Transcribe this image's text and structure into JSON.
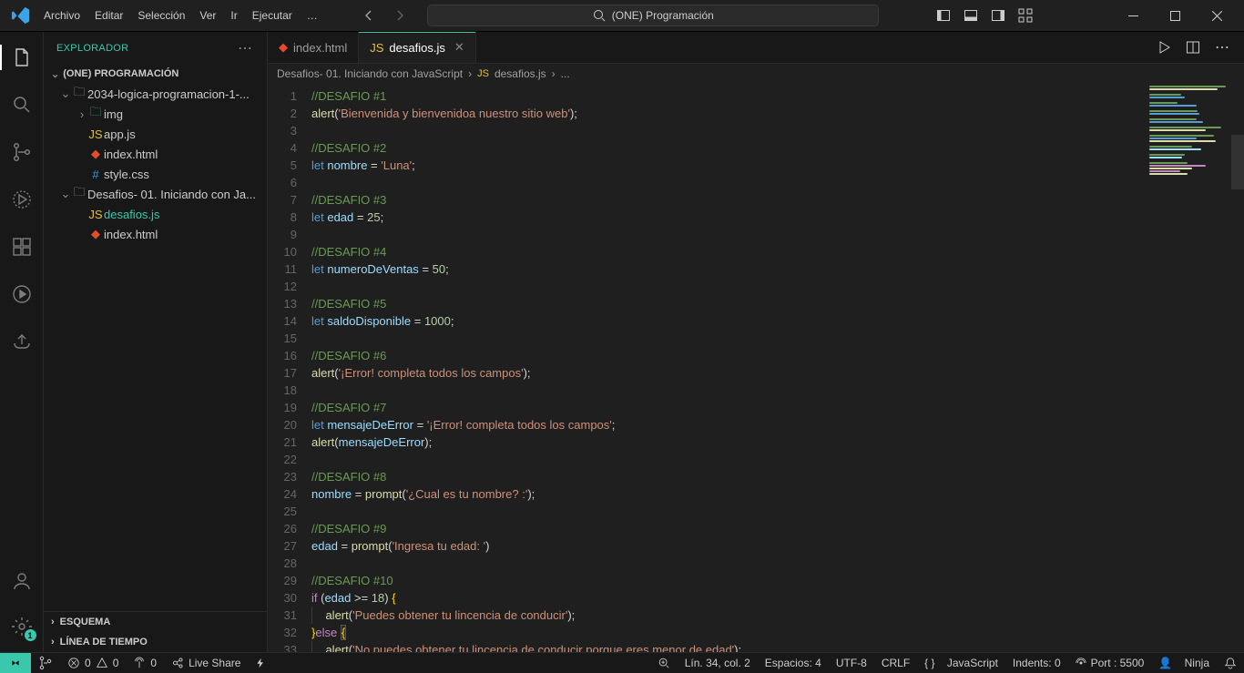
{
  "menu": [
    "Archivo",
    "Editar",
    "Selección",
    "Ver",
    "Ir",
    "Ejecutar"
  ],
  "menu_overflow": "…",
  "search_center": "(ONE) Programación",
  "explorer": {
    "title": "EXPLORADOR",
    "root": "(ONE) PROGRAMACIÓN",
    "folder1": "2034-logica-programacion-1-...",
    "img": "img",
    "appjs": "app.js",
    "indexhtml": "index.html",
    "stylecss": "style.css",
    "folder2": "Desafios- 01. Iniciando con Ja...",
    "desafiosjs": "desafios.js",
    "indexhtml2": "index.html",
    "esquema": "ESQUEMA",
    "linea": "LÍNEA DE TIEMPO"
  },
  "tabs": {
    "indexhtml": "index.html",
    "desafiosjs": "desafios.js"
  },
  "breadcrumbs": {
    "seg1": "Desafios- 01. Iniciando con JavaScript",
    "seg2": "desafios.js",
    "seg3": "..."
  },
  "code_lines": [
    {
      "n": 1,
      "t": [
        [
          "cm",
          "//DESAFIO #1"
        ]
      ]
    },
    {
      "n": 2,
      "t": [
        [
          "fn",
          "alert"
        ],
        [
          "p",
          "("
        ],
        [
          "str",
          "'Bienvenida y bienvenidoa nuestro sitio web'"
        ],
        [
          "p",
          ");"
        ]
      ]
    },
    {
      "n": 3,
      "t": []
    },
    {
      "n": 4,
      "t": [
        [
          "cm",
          "//DESAFIO #2"
        ]
      ]
    },
    {
      "n": 5,
      "t": [
        [
          "kw",
          "let "
        ],
        [
          "id",
          "nombre"
        ],
        [
          "p",
          " = "
        ],
        [
          "str",
          "'Luna'"
        ],
        [
          "p",
          ";"
        ]
      ]
    },
    {
      "n": 6,
      "t": []
    },
    {
      "n": 7,
      "t": [
        [
          "cm",
          "//DESAFIO #3"
        ]
      ]
    },
    {
      "n": 8,
      "t": [
        [
          "kw",
          "let "
        ],
        [
          "id",
          "edad"
        ],
        [
          "p",
          " = "
        ],
        [
          "num",
          "25"
        ],
        [
          "p",
          ";"
        ]
      ]
    },
    {
      "n": 9,
      "t": []
    },
    {
      "n": 10,
      "t": [
        [
          "cm",
          "//DESAFIO #4"
        ]
      ]
    },
    {
      "n": 11,
      "t": [
        [
          "kw",
          "let "
        ],
        [
          "id",
          "numeroDeVentas"
        ],
        [
          "p",
          " = "
        ],
        [
          "num",
          "50"
        ],
        [
          "p",
          ";"
        ]
      ]
    },
    {
      "n": 12,
      "t": []
    },
    {
      "n": 13,
      "t": [
        [
          "cm",
          "//DESAFIO #5"
        ]
      ]
    },
    {
      "n": 14,
      "t": [
        [
          "kw",
          "let "
        ],
        [
          "id",
          "saldoDisponible"
        ],
        [
          "p",
          " = "
        ],
        [
          "num",
          "1000"
        ],
        [
          "p",
          ";"
        ]
      ]
    },
    {
      "n": 15,
      "t": []
    },
    {
      "n": 16,
      "t": [
        [
          "cm",
          "//DESAFIO #6"
        ]
      ]
    },
    {
      "n": 17,
      "t": [
        [
          "fn",
          "alert"
        ],
        [
          "p",
          "("
        ],
        [
          "str",
          "'¡Error! completa todos los campos'"
        ],
        [
          "p",
          ");"
        ]
      ]
    },
    {
      "n": 18,
      "t": []
    },
    {
      "n": 19,
      "t": [
        [
          "cm",
          "//DESAFIO #7"
        ]
      ]
    },
    {
      "n": 20,
      "t": [
        [
          "kw",
          "let "
        ],
        [
          "id",
          "mensajeDeError"
        ],
        [
          "p",
          " = "
        ],
        [
          "str",
          "'¡Error! completa todos los campos'"
        ],
        [
          "p",
          ";"
        ]
      ]
    },
    {
      "n": 21,
      "t": [
        [
          "fn",
          "alert"
        ],
        [
          "p",
          "("
        ],
        [
          "id",
          "mensajeDeError"
        ],
        [
          "p",
          ");"
        ]
      ]
    },
    {
      "n": 22,
      "t": []
    },
    {
      "n": 23,
      "t": [
        [
          "cm",
          "//DESAFIO #8"
        ]
      ]
    },
    {
      "n": 24,
      "t": [
        [
          "id",
          "nombre"
        ],
        [
          "p",
          " = "
        ],
        [
          "fn",
          "prompt"
        ],
        [
          "p",
          "("
        ],
        [
          "str",
          "'¿Cual es tu nombre? :'"
        ],
        [
          "p",
          ");"
        ]
      ]
    },
    {
      "n": 25,
      "t": []
    },
    {
      "n": 26,
      "t": [
        [
          "cm",
          "//DESAFIO #9"
        ]
      ]
    },
    {
      "n": 27,
      "t": [
        [
          "id",
          "edad"
        ],
        [
          "p",
          " = "
        ],
        [
          "fn",
          "prompt"
        ],
        [
          "p",
          "("
        ],
        [
          "str",
          "'Ingresa tu edad: '"
        ],
        [
          "p",
          ")"
        ]
      ]
    },
    {
      "n": 28,
      "t": []
    },
    {
      "n": 29,
      "t": [
        [
          "cm",
          "//DESAFIO #10"
        ]
      ]
    },
    {
      "n": 30,
      "t": [
        [
          "kw2",
          "if"
        ],
        [
          "p",
          " ("
        ],
        [
          "id",
          "edad"
        ],
        [
          "p",
          " >= "
        ],
        [
          "num",
          "18"
        ],
        [
          "p",
          ") "
        ],
        [
          "br",
          "{"
        ]
      ]
    },
    {
      "n": 31,
      "t": [
        [
          "indent",
          ""
        ],
        [
          "fn",
          "alert"
        ],
        [
          "p",
          "("
        ],
        [
          "str",
          "'Puedes obtener tu lincencia de conducir'"
        ],
        [
          "p",
          ");"
        ]
      ]
    },
    {
      "n": 32,
      "t": [
        [
          "br",
          "}"
        ],
        [
          "kw2",
          "else"
        ],
        [
          "p",
          " "
        ],
        [
          "brhl",
          "{"
        ]
      ]
    },
    {
      "n": 33,
      "t": [
        [
          "indent",
          ""
        ],
        [
          "fn",
          "alert"
        ],
        [
          "p",
          "("
        ],
        [
          "str",
          "'No puedes obtener tu lincencia de conducir porque eres menor de edad'"
        ],
        [
          "p",
          ");"
        ]
      ]
    }
  ],
  "status": {
    "errors": "0",
    "warnings": "0",
    "radio": "0",
    "live": "Live Share",
    "lncol": "Lín. 34, col. 2",
    "spaces": "Espacios: 4",
    "enc": "UTF-8",
    "eol": "CRLF",
    "lang": "JavaScript",
    "indents": "Indents: 0",
    "port": "Port : 5500",
    "ninja": "Ninja"
  }
}
